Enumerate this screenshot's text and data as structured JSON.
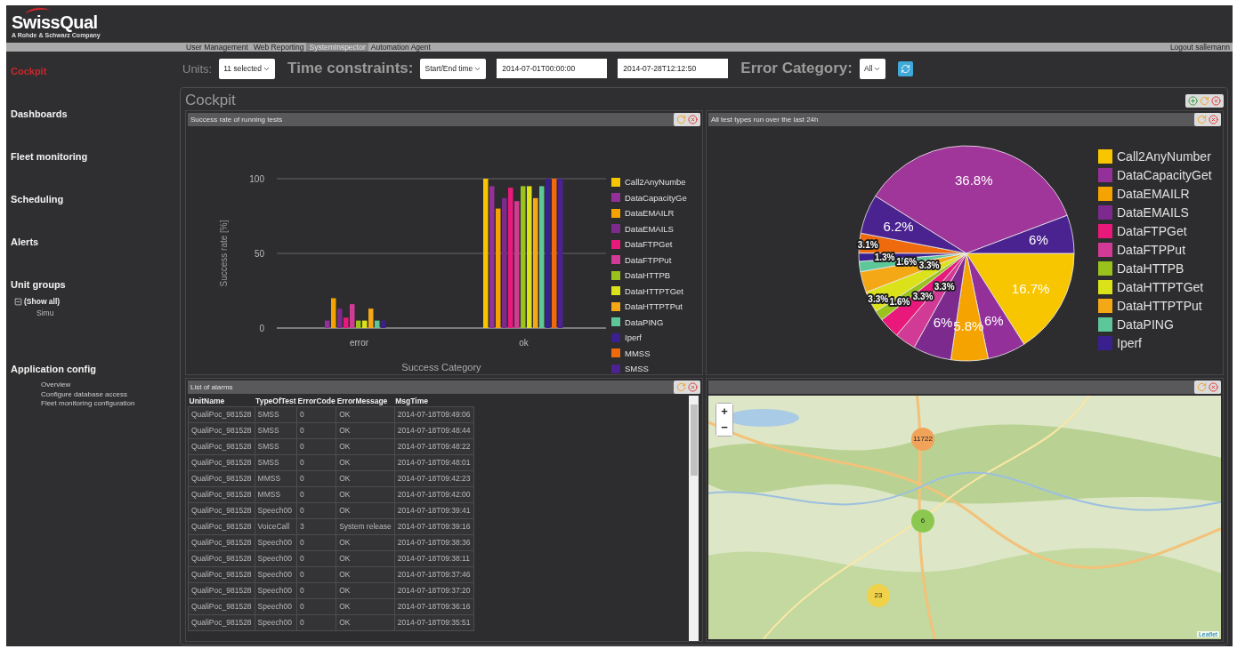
{
  "app": {
    "logo": "SwissQual",
    "tagline": "A Rohde & Schwarz Company"
  },
  "top_menu": {
    "items": [
      {
        "label": "User Management",
        "selected": false
      },
      {
        "label": "Web Reporting",
        "selected": false
      },
      {
        "label": "SystemInspector",
        "selected": true
      },
      {
        "label": "Automation Agent",
        "selected": false
      }
    ],
    "logout": "Logout sallemann"
  },
  "sidebar": {
    "items": [
      {
        "kind": "nav",
        "label": "Cockpit",
        "selected": true
      },
      {
        "kind": "nav",
        "label": "Dashboards",
        "selected": false
      },
      {
        "kind": "nav",
        "label": "Fleet monitoring",
        "selected": false
      },
      {
        "kind": "nav",
        "label": "Scheduling",
        "selected": false
      },
      {
        "kind": "nav",
        "label": "Alerts",
        "selected": false
      },
      {
        "kind": "tree",
        "label": "Unit groups",
        "children": [
          {
            "label": "(Show all)",
            "expanded": true,
            "children": [
              {
                "label": "Simu"
              }
            ]
          }
        ]
      },
      {
        "kind": "links",
        "label": "Application config",
        "links": [
          "Overview",
          "Configure database access",
          "Fleet monitoring configuration"
        ]
      }
    ]
  },
  "filters": {
    "units_label": "Units:",
    "units_value": "11 selected",
    "time_label": "Time constraints:",
    "time_mode": "Start/End time",
    "start": "2014-07-01T00:00:00",
    "end": "2014-07-28T12:12:50",
    "error_label": "Error Category:",
    "error_value": "All"
  },
  "cockpit": {
    "title": "Cockpit",
    "widgets": [
      {
        "kind": "bar_chart",
        "title": "Success rate of running tests",
        "chart_data": {
          "type": "bar",
          "xlabel": "Success Category",
          "ylabel": "Success rate [%]",
          "categories": [
            "error",
            "ok"
          ],
          "ylim": [
            0,
            100
          ],
          "yticks": [
            0,
            50,
            100
          ],
          "series": [
            {
              "name": "Call2AnyNumbe",
              "color": "#f7c600",
              "values": [
                null,
                100
              ]
            },
            {
              "name": "DataCapacityGe",
              "color": "#93309a",
              "values": [
                5,
                95
              ]
            },
            {
              "name": "DataEMAILR",
              "color": "#f5a300",
              "values": [
                20,
                80
              ]
            },
            {
              "name": "DataEMAILS",
              "color": "#7d2a8f",
              "values": [
                13,
                87
              ]
            },
            {
              "name": "DataFTPGet",
              "color": "#e8197a",
              "values": [
                7,
                94
              ]
            },
            {
              "name": "DataFTPPut",
              "color": "#d13a95",
              "values": [
                16,
                85
              ]
            },
            {
              "name": "DataHTTPB",
              "color": "#9ac21c",
              "values": [
                5,
                95
              ]
            },
            {
              "name": "DataHTTPTGet",
              "color": "#dce21a",
              "values": [
                5,
                95
              ]
            },
            {
              "name": "DataHTTPTPut",
              "color": "#f5a816",
              "values": [
                13,
                87
              ]
            },
            {
              "name": "DataPING",
              "color": "#5ec79a",
              "values": [
                5,
                95
              ]
            },
            {
              "name": "Iperf",
              "color": "#3a1f8f",
              "values": [
                5,
                100
              ]
            },
            {
              "name": "MMSS",
              "color": "#ef6a0c",
              "values": [
                null,
                100
              ]
            },
            {
              "name": "SMSS",
              "color": "#4b2390",
              "values": [
                null,
                100
              ]
            }
          ]
        }
      },
      {
        "kind": "pie_chart",
        "title": "All test types run over the last 24h",
        "chart_data": {
          "type": "pie",
          "data_labels": true,
          "values": [
            16.7,
            6,
            5.8,
            6,
            3.3,
            3.3,
            1.6,
            3.3,
            3.3,
            1.6,
            1.3,
            3.1,
            6.2,
            36.8,
            6
          ],
          "value_labels": [
            "16.7%",
            "6%",
            "5.8%",
            "6%",
            "3.3%",
            "3.3%",
            "1.6%",
            "3.3%",
            "3.3%",
            "1.6%",
            "1.3%",
            "3.1%",
            "6.2%",
            "36.8%",
            "6%"
          ],
          "colors": [
            "#f7c600",
            "#93309a",
            "#f5a300",
            "#7d2a8f",
            "#d13a95",
            "#e8197a",
            "#9ac21c",
            "#dce21a",
            "#f5a816",
            "#5ec79a",
            "#3a1f8f",
            "#ef6a0c",
            "#4b2390",
            "#a0359a",
            "#4b2390"
          ]
        },
        "legend": [
          {
            "label": "Call2AnyNumber",
            "color": "#f7c600"
          },
          {
            "label": "DataCapacityGet",
            "color": "#93309a"
          },
          {
            "label": "DataEMAILR",
            "color": "#f5a300"
          },
          {
            "label": "DataEMAILS",
            "color": "#7d2a8f"
          },
          {
            "label": "DataFTPGet",
            "color": "#e8197a"
          },
          {
            "label": "DataFTPPut",
            "color": "#d13a95"
          },
          {
            "label": "DataHTTPB",
            "color": "#9ac21c"
          },
          {
            "label": "DataHTTPTGet",
            "color": "#dce21a"
          },
          {
            "label": "DataHTTPTPut",
            "color": "#f5a816"
          },
          {
            "label": "DataPING",
            "color": "#5ec79a"
          },
          {
            "label": "Iperf",
            "color": "#3a1f8f"
          }
        ]
      },
      {
        "kind": "table",
        "title": "List of alarms",
        "columns": [
          "UnitName",
          "TypeOfTest",
          "ErrorCode",
          "ErrorMessage",
          "MsgTime"
        ],
        "rows": [
          [
            "QualiPoc_981528",
            "SMSS",
            "0",
            "OK",
            "2014-07-18T09:49:06"
          ],
          [
            "QualiPoc_981528",
            "SMSS",
            "0",
            "OK",
            "2014-07-18T09:48:44"
          ],
          [
            "QualiPoc_981528",
            "SMSS",
            "0",
            "OK",
            "2014-07-18T09:48:22"
          ],
          [
            "QualiPoc_981528",
            "SMSS",
            "0",
            "OK",
            "2014-07-18T09:48:01"
          ],
          [
            "QualiPoc_981528",
            "MMSS",
            "0",
            "OK",
            "2014-07-18T09:42:23"
          ],
          [
            "QualiPoc_981528",
            "MMSS",
            "0",
            "OK",
            "2014-07-18T09:42:00"
          ],
          [
            "QualiPoc_981528",
            "Speech00",
            "0",
            "OK",
            "2014-07-18T09:39:41"
          ],
          [
            "QualiPoc_981528",
            "VoiceCall",
            "3",
            "System release",
            "2014-07-18T09:39:16"
          ],
          [
            "QualiPoc_981528",
            "Speech00",
            "0",
            "OK",
            "2014-07-18T09:38:36"
          ],
          [
            "QualiPoc_981528",
            "Speech00",
            "0",
            "OK",
            "2014-07-18T09:38:11"
          ],
          [
            "QualiPoc_981528",
            "Speech00",
            "0",
            "OK",
            "2014-07-18T09:37:46"
          ],
          [
            "QualiPoc_981528",
            "Speech00",
            "0",
            "OK",
            "2014-07-18T09:37:20"
          ],
          [
            "QualiPoc_981528",
            "Speech00",
            "0",
            "OK",
            "2014-07-18T09:36:16"
          ],
          [
            "QualiPoc_981528",
            "Speech00",
            "0",
            "OK",
            "2014-07-18T09:35:51"
          ]
        ]
      },
      {
        "kind": "map",
        "zoom_in": "+",
        "zoom_out": "−",
        "attribution": "Leaflet",
        "markers": [
          {
            "kind": "large",
            "count": "11722"
          },
          {
            "kind": "small",
            "count": "6"
          },
          {
            "kind": "medium",
            "count": "23"
          }
        ]
      }
    ]
  }
}
